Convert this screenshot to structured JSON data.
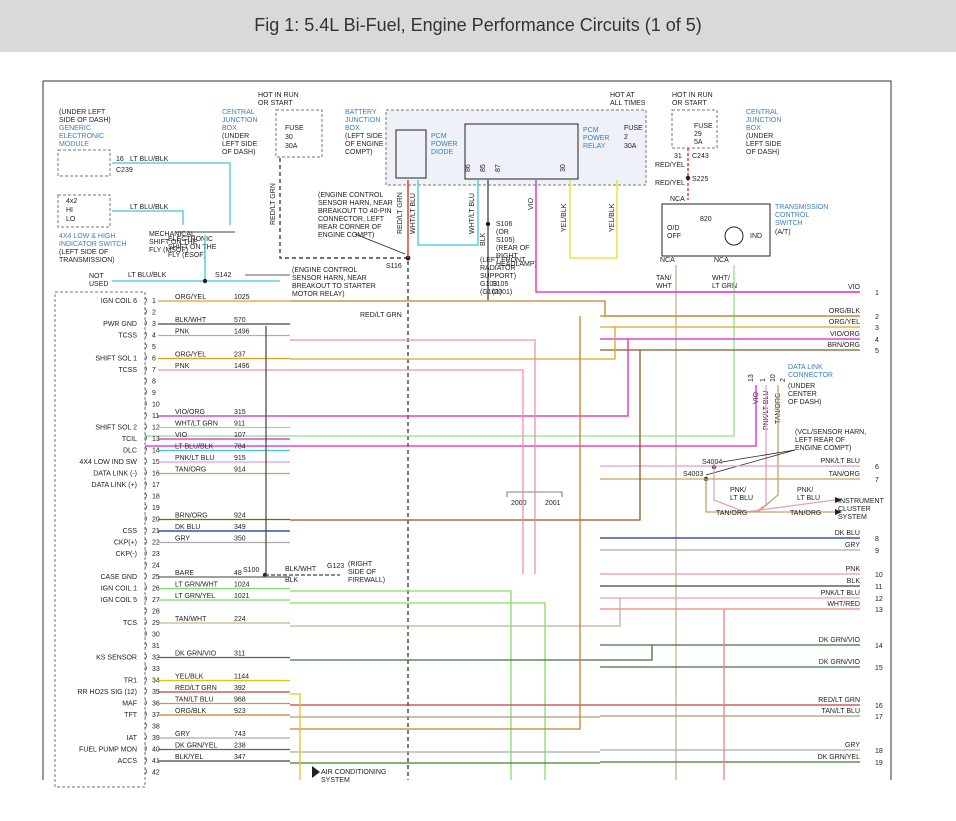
{
  "title": "Fig 1: 5.4L Bi-Fuel, Engine Performance Circuits (1 of 5)",
  "pcm_pins": [
    {
      "n": "1",
      "label": "IGN COIL 6",
      "color": "ORG/YEL",
      "circuit": "1025"
    },
    {
      "n": "2",
      "label": "",
      "color": "",
      "circuit": ""
    },
    {
      "n": "3",
      "label": "PWR GND",
      "color": "BLK/WHT",
      "circuit": "570"
    },
    {
      "n": "4",
      "label": "TCSS",
      "color": "PNK",
      "circuit": "1496"
    },
    {
      "n": "5",
      "label": "",
      "color": "",
      "circuit": ""
    },
    {
      "n": "6",
      "label": "SHIFT SOL 1",
      "color": "ORG/YEL",
      "circuit": "237"
    },
    {
      "n": "7",
      "label": "TCSS",
      "color": "PNK",
      "circuit": "1496"
    },
    {
      "n": "8",
      "label": "",
      "color": "",
      "circuit": ""
    },
    {
      "n": "9",
      "label": "",
      "color": "",
      "circuit": ""
    },
    {
      "n": "10",
      "label": "",
      "color": "",
      "circuit": ""
    },
    {
      "n": "11",
      "label": "",
      "color": "VIO/ORG",
      "circuit": "315"
    },
    {
      "n": "12",
      "label": "SHIFT SOL 2",
      "color": "WHT/LT GRN",
      "circuit": "911"
    },
    {
      "n": "13",
      "label": "TCIL",
      "color": "VIO",
      "circuit": "107"
    },
    {
      "n": "14",
      "label": "DLC",
      "color": "LT BLU/BLK",
      "circuit": "784"
    },
    {
      "n": "15",
      "label": "4X4 LOW IND SW",
      "color": "PNK/LT BLU",
      "circuit": "915"
    },
    {
      "n": "16",
      "label": "DATA LINK (-)",
      "color": "TAN/ORG",
      "circuit": "914"
    },
    {
      "n": "17",
      "label": "DATA LINK (+)",
      "color": "",
      "circuit": ""
    },
    {
      "n": "18",
      "label": "",
      "color": "",
      "circuit": ""
    },
    {
      "n": "19",
      "label": "",
      "color": "",
      "circuit": ""
    },
    {
      "n": "20",
      "label": "",
      "color": "BRN/ORG",
      "circuit": "924"
    },
    {
      "n": "21",
      "label": "CSS",
      "color": "DK BLU",
      "circuit": "349"
    },
    {
      "n": "22",
      "label": "CKP(+)",
      "color": "GRY",
      "circuit": "350"
    },
    {
      "n": "23",
      "label": "CKP(-)",
      "color": "",
      "circuit": ""
    },
    {
      "n": "24",
      "label": "",
      "color": "",
      "circuit": ""
    },
    {
      "n": "25",
      "label": "CASE GND",
      "color": "BARE",
      "circuit": "48"
    },
    {
      "n": "26",
      "label": "IGN COIL 1",
      "color": "LT GRN/WHT",
      "circuit": "1024"
    },
    {
      "n": "27",
      "label": "IGN COIL 5",
      "color": "LT GRN/YEL",
      "circuit": "1021"
    },
    {
      "n": "28",
      "label": "",
      "color": "",
      "circuit": ""
    },
    {
      "n": "29",
      "label": "TCS",
      "color": "TAN/WHT",
      "circuit": "224"
    },
    {
      "n": "30",
      "label": "",
      "color": "",
      "circuit": ""
    },
    {
      "n": "31",
      "label": "",
      "color": "",
      "circuit": ""
    },
    {
      "n": "32",
      "label": "KS SENSOR",
      "color": "DK GRN/VIO",
      "circuit": "311"
    },
    {
      "n": "33",
      "label": "",
      "color": "",
      "circuit": ""
    },
    {
      "n": "34",
      "label": "TR1",
      "color": "YEL/BLK",
      "circuit": "1144"
    },
    {
      "n": "35",
      "label": "RR HO2S SIG (12)",
      "color": "RED/LT GRN",
      "circuit": "392"
    },
    {
      "n": "36",
      "label": "MAF",
      "color": "TAN/LT BLU",
      "circuit": "968"
    },
    {
      "n": "37",
      "label": "TFT",
      "color": "ORG/BLK",
      "circuit": "923"
    },
    {
      "n": "38",
      "label": "",
      "color": "",
      "circuit": ""
    },
    {
      "n": "39",
      "label": "IAT",
      "color": "GRY",
      "circuit": "743"
    },
    {
      "n": "40",
      "label": "FUEL PUMP MON",
      "color": "DK GRN/YEL",
      "circuit": "238"
    },
    {
      "n": "41",
      "label": "ACCS",
      "color": "BLK/YEL",
      "circuit": "347"
    },
    {
      "n": "42",
      "label": "",
      "color": "",
      "circuit": ""
    }
  ],
  "right_wires": [
    {
      "label": "VIO",
      "n": "1",
      "color": "#e020c0"
    },
    {
      "label": "ORG/BLK",
      "n": "2",
      "color": "#c8802a"
    },
    {
      "label": "ORG/YEL",
      "n": "3",
      "color": "#e8a020"
    },
    {
      "label": "VIO/ORG",
      "n": "4",
      "color": "#e020c0"
    },
    {
      "label": "BRN/ORG",
      "n": "5",
      "color": "#8a5a20"
    },
    {
      "label": "PNK/LT BLU",
      "n": "6",
      "color": "#e8a0c0"
    },
    {
      "label": "TAN/ORG",
      "n": "7",
      "color": "#c8a060"
    },
    {
      "label": "DK BLU",
      "n": "8",
      "color": "#1030a0"
    },
    {
      "label": "GRY",
      "n": "9",
      "color": "#aaaaaa"
    },
    {
      "label": "PNK",
      "n": "10",
      "color": "#f090b0"
    },
    {
      "label": "BLK",
      "n": "11",
      "color": "#444444"
    },
    {
      "label": "PNK/LT BLU",
      "n": "12",
      "color": "#e8a0c0"
    },
    {
      "label": "WHT/RED",
      "n": "13",
      "color": "#f08080"
    },
    {
      "label": "DK GRN/VIO",
      "n": "14",
      "color": "#407040"
    },
    {
      "label": "DK GRN/VIO",
      "n": "15",
      "color": "#407040"
    },
    {
      "label": "RED/LT GRN",
      "n": "16",
      "color": "#c04040"
    },
    {
      "label": "TAN/LT BLU",
      "n": "17",
      "color": "#a0a080"
    },
    {
      "label": "GRY",
      "n": "18",
      "color": "#aaaaaa"
    },
    {
      "label": "DK GRN/YEL",
      "n": "19",
      "color": "#408030"
    }
  ],
  "labels": {
    "generic_module": [
      "(UNDER LEFT",
      "SIDE OF DASH)",
      "GENERIC",
      "ELECTRONIC",
      "MODULE"
    ],
    "gem_wire": "LT BLU/BLK",
    "gem_pin": "16",
    "gem_conn": "C239",
    "sw4x4_title": [
      "4X4 LOW & HIGH",
      "INDICATOR SWITCH"
    ],
    "sw4x4_loc": [
      "(LEFT SIDE OF",
      "TRANSMISSION)"
    ],
    "sw4x4_pos": [
      "4x2",
      "HI",
      "LO"
    ],
    "sw4x4_wire": "LT BLU/BLK",
    "shift_motor": [
      "MECHANICAL",
      "SHIFT ON THE",
      "FLY (MSOF)"
    ],
    "shift_motor2": [
      "ELECTRONIC",
      "SHIFT ON THE",
      "FLY (ESOF)"
    ],
    "not_used": [
      "NOT",
      "USED"
    ],
    "not_used_wire": "LT BLU/BLK",
    "s142": "S142",
    "s142_note": [
      "(ENGINE CONTROL",
      "SENSOR HARN, NEAR",
      "BREAKOUT TO STARTER",
      "MOTOR RELAY)"
    ],
    "cjb1_hot": [
      "HOT IN RUN",
      "OR START"
    ],
    "cjb1_title": [
      "CENTRAL",
      "JUNCTION",
      "BOX"
    ],
    "cjb1_loc": [
      "(UNDER",
      "LEFT SIDE",
      "OF DASH)"
    ],
    "cjb1_fuse": [
      "FUSE",
      "30",
      "30A"
    ],
    "cjb1_wire": "RED/LT GRN",
    "s116": "S116",
    "ecs_note": [
      "(ENGINE CONTROL",
      "SENSOR HARN, NEAR",
      "BREAKOUT TO 40-PIN",
      "CONNECTOR, LEFT",
      "REAR CORNER OF",
      "ENGINE COMPT)"
    ],
    "bjb_title": [
      "BATTERY",
      "JUNCTION",
      "BOX"
    ],
    "bjb_loc": [
      "(LEFT SIDE",
      "OF ENGINE",
      "COMPT)"
    ],
    "pcm_diode": [
      "PCM",
      "POWER",
      "DIODE"
    ],
    "pcm_relay": [
      "PCM",
      "POWER",
      "RELAY"
    ],
    "hot_all": [
      "HOT AT",
      "ALL TIMES"
    ],
    "bjb_fuse": [
      "FUSE",
      "2",
      "30A"
    ],
    "relay_pins": [
      "86",
      "85",
      "87",
      "30"
    ],
    "bjb_wires": [
      "RED/LT GRN",
      "WHT/LT BLU",
      "WHT/LT BLU",
      "BLK",
      "VIO",
      "YEL/BLK",
      "YEL/BLK"
    ],
    "s106": [
      "S106",
      "(OR",
      "S105)",
      "(REAR OF",
      "RIGHT",
      "HEADLAMP)"
    ],
    "g_note": [
      "(LEFT FRONT",
      "RADIATOR",
      "SUPPORT)",
      "G103",
      "(G101)"
    ],
    "s105": [
      "S105",
      "(2001)"
    ],
    "cjb2_hot": [
      "HOT IN RUN",
      "OR START"
    ],
    "cjb2_title": [
      "CENTRAL",
      "JUNCTION",
      "BOX"
    ],
    "cjb2_loc": [
      "(UNDER",
      "LEFT SIDE",
      "OF DASH)"
    ],
    "cjb2_fuse": [
      "FUSE",
      "29",
      "5A"
    ],
    "c243": [
      "31",
      "C243"
    ],
    "redyel": "RED/YEL",
    "redyel2": "RED/YEL",
    "s225": "S225",
    "tcs_title": [
      "TRANSMISSION",
      "CONTROL",
      "SWITCH"
    ],
    "tcs_sub": "(A/T)",
    "tcs_inner": [
      "NCA",
      "820",
      "O/D",
      "OFF",
      "IND",
      "NCA",
      "NCA"
    ],
    "tcs_wires": [
      "TAN/",
      "WHT",
      "WHT/",
      "LT GRN"
    ],
    "dlc_title": [
      "DATA LINK",
      "CONNECTOR"
    ],
    "dlc_loc": [
      "(UNDER",
      "CENTER",
      "OF DASH)"
    ],
    "dlc_pins": [
      "13",
      "1",
      "10",
      "2"
    ],
    "dlc_wires": [
      "VIO",
      "PNK/LT BLU",
      "TAN/ORG"
    ],
    "vcl_note": [
      "(VCL/SENSOR HARN,",
      "LEFT REAR OF",
      "ENGINE COMPT)"
    ],
    "s4004": "S4004",
    "s4003": "S4003",
    "ic_wires": [
      "PNK/",
      "LT BLU",
      "PNK/",
      "LT BLU",
      "TAN/ORG",
      "TAN/ORG"
    ],
    "ic": [
      "INSTRUMENT",
      "CLUSTER",
      "SYSTEM"
    ],
    "yr": [
      "2000",
      "2001"
    ],
    "s100": "S100",
    "g123": "G123",
    "g123_note": [
      "(RIGHT",
      "SIDE OF",
      "FIREWALL)"
    ],
    "gnd_wire": [
      "BLK/WHT",
      "BLK"
    ],
    "ac": [
      "AIR CONDITIONING",
      "SYSTEM"
    ],
    "redltgrn_main": "RED/LT GRN"
  }
}
